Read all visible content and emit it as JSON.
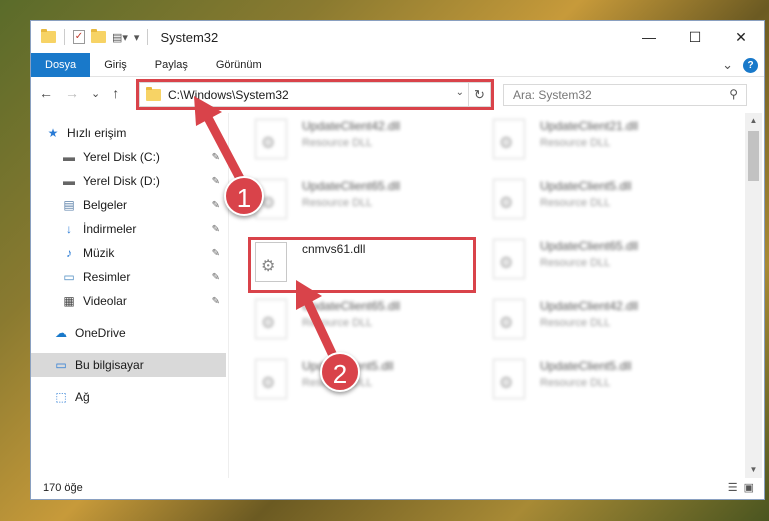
{
  "window": {
    "title": "System32",
    "controls": {
      "minimize": "—",
      "maximize": "☐",
      "close": "✕"
    }
  },
  "ribbon": {
    "tabs": [
      {
        "label": "Dosya",
        "active": true
      },
      {
        "label": "Giriş"
      },
      {
        "label": "Paylaş"
      },
      {
        "label": "Görünüm"
      }
    ],
    "expand": "⌄",
    "help": "?"
  },
  "nav": {
    "back": "←",
    "forward": "→",
    "recent": "⌄",
    "up": "↑"
  },
  "address": {
    "path": "C:\\Windows\\System32",
    "dropdown": "⌄",
    "refresh": "↻"
  },
  "search": {
    "placeholder": "Ara: System32",
    "icon": "⚲"
  },
  "sidebar": {
    "items": [
      {
        "label": "Hızlı erişim",
        "icon": "★",
        "pinned": false
      },
      {
        "label": "Yerel Disk (C:)",
        "icon": "▬",
        "pinned": true
      },
      {
        "label": "Yerel Disk (D:)",
        "icon": "▬",
        "pinned": true
      },
      {
        "label": "Belgeler",
        "icon": "▤",
        "pinned": true
      },
      {
        "label": "İndirmeler",
        "icon": "↓",
        "pinned": true
      },
      {
        "label": "Müzik",
        "icon": "♪",
        "pinned": true
      },
      {
        "label": "Resimler",
        "icon": "▭",
        "pinned": true
      },
      {
        "label": "Videolar",
        "icon": "▦",
        "pinned": true
      },
      {
        "label": "OneDrive",
        "icon": "☁",
        "pinned": false
      },
      {
        "label": "Bu bilgisayar",
        "icon": "▭",
        "pinned": false,
        "selected": true
      },
      {
        "label": "Ağ",
        "icon": "⬚",
        "pinned": false
      }
    ],
    "pin_icon": "✎"
  },
  "files": [
    {
      "name": "UpdateClient42.dll",
      "type": "Resource DLL",
      "blurred": true
    },
    {
      "name": "UpdateClient21.dll",
      "type": "Resource DLL",
      "blurred": true
    },
    {
      "name": "UpdateClient65.dll",
      "type": "Resource DLL",
      "blurred": true
    },
    {
      "name": "UpdateClient5.dll",
      "type": "Resource DLL",
      "blurred": true
    },
    {
      "name": "cnmvs61.dll",
      "type": "",
      "blurred": false
    },
    {
      "name": "UpdateClient65.dll",
      "type": "Resource DLL",
      "blurred": true
    },
    {
      "name": "UpdateClient65.dll",
      "type": "Resource DLL",
      "blurred": true
    },
    {
      "name": "UpdateClient42.dll",
      "type": "Resource DLL",
      "blurred": true
    },
    {
      "name": "UpdateClient5.dll",
      "type": "Resource DLL",
      "blurred": true
    },
    {
      "name": "UpdateClient5.dll",
      "type": "Resource DLL",
      "blurred": true
    }
  ],
  "status": {
    "count": "170 öğe"
  },
  "annotations": {
    "step1": "1",
    "step2": "2",
    "color": "#d9434a"
  }
}
